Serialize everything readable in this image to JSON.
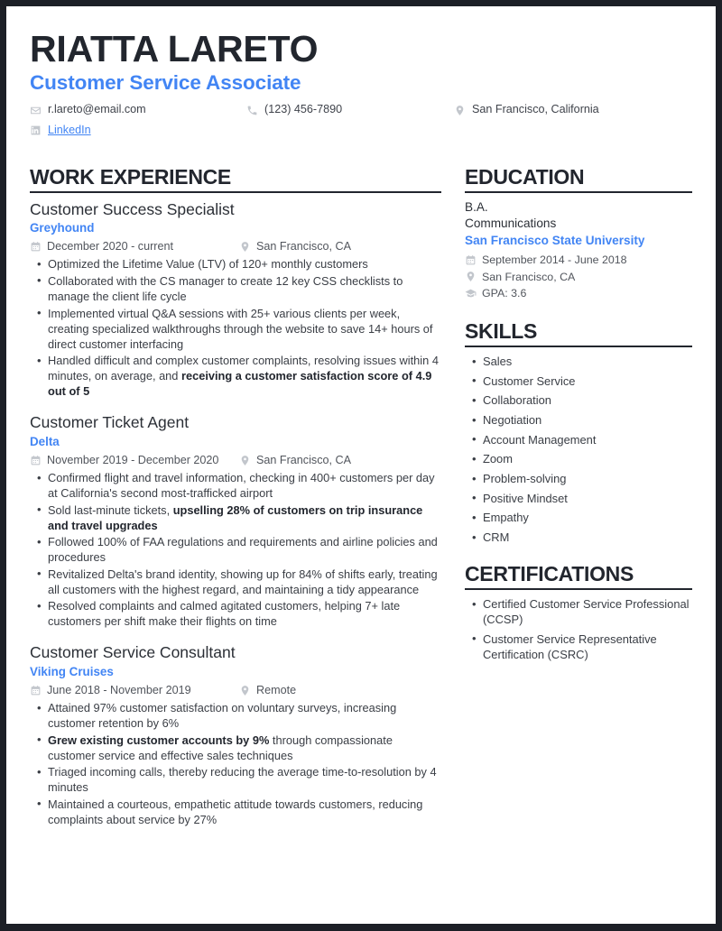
{
  "header": {
    "name": "RIATTA LARETO",
    "job_title": "Customer Service Associate",
    "contacts": {
      "email": "r.lareto@email.com",
      "phone": "(123) 456-7890",
      "location": "San Francisco, California",
      "linkedin": "LinkedIn"
    }
  },
  "accent_color": "#4285f4",
  "text_color": "#22262e",
  "work": {
    "section_title": "WORK EXPERIENCE",
    "entries": [
      {
        "title": "Customer Success Specialist",
        "org": "Greyhound",
        "date": "December 2020 - current",
        "location": "San Francisco, CA",
        "bullets": [
          [
            {
              "t": "Optimized the Lifetime Value (LTV) of 120+ monthly customers",
              "b": false
            }
          ],
          [
            {
              "t": "Collaborated with the CS manager to create 12 key CSS checklists to manage the client life cycle",
              "b": false
            }
          ],
          [
            {
              "t": "Implemented virtual Q&A sessions with 25+ various clients per week, creating specialized walkthroughs through the website to save 14+ hours of direct customer interfacing",
              "b": false
            }
          ],
          [
            {
              "t": "Handled difficult and complex customer complaints, resolving issues within 4 minutes, on average, and ",
              "b": false
            },
            {
              "t": "receiving a customer satisfaction score of 4.9 out of 5",
              "b": true
            }
          ]
        ]
      },
      {
        "title": "Customer Ticket Agent",
        "org": "Delta",
        "date": "November 2019 - December 2020",
        "location": "San Francisco, CA",
        "bullets": [
          [
            {
              "t": "Confirmed flight and travel information, checking in 400+ customers per day at California's second most-trafficked airport",
              "b": false
            }
          ],
          [
            {
              "t": "Sold last-minute tickets, ",
              "b": false
            },
            {
              "t": "upselling 28% of customers on trip insurance and travel upgrades",
              "b": true
            }
          ],
          [
            {
              "t": "Followed 100% of FAA regulations and requirements and airline policies and procedures",
              "b": false
            }
          ],
          [
            {
              "t": "Revitalized Delta's brand identity, showing up for 84% of shifts early, treating all customers with the highest regard, and maintaining a tidy appearance",
              "b": false
            }
          ],
          [
            {
              "t": "Resolved complaints and calmed agitated customers, helping 7+ late customers per shift make their flights on time",
              "b": false
            }
          ]
        ]
      },
      {
        "title": "Customer Service Consultant",
        "org": "Viking Cruises",
        "date": "June 2018 - November 2019",
        "location": "Remote",
        "bullets": [
          [
            {
              "t": "Attained 97% customer satisfaction on voluntary surveys, increasing customer retention by 6%",
              "b": false
            }
          ],
          [
            {
              "t": "Grew existing customer accounts by 9%",
              "b": true
            },
            {
              "t": " through compassionate customer service and effective sales techniques",
              "b": false
            }
          ],
          [
            {
              "t": "Triaged incoming calls, thereby reducing the average time-to-resolution by 4 minutes",
              "b": false
            }
          ],
          [
            {
              "t": "Maintained a courteous, empathetic attitude towards customers, reducing complaints about service by 27%",
              "b": false
            }
          ]
        ]
      }
    ]
  },
  "education": {
    "section_title": "EDUCATION",
    "degree": "B.A.",
    "field": "Communications",
    "school": "San Francisco State University",
    "date": "September 2014 - June 2018",
    "location": "San Francisco, CA",
    "gpa": "GPA: 3.6"
  },
  "skills": {
    "section_title": "SKILLS",
    "items": [
      "Sales",
      "Customer Service",
      "Collaboration",
      "Negotiation",
      "Account Management",
      "Zoom",
      "Problem-solving",
      "Positive Mindset",
      "Empathy",
      "CRM"
    ]
  },
  "certifications": {
    "section_title": "CERTIFICATIONS",
    "items": [
      "Certified Customer Service Professional (CCSP)",
      "Customer Service Representative Certification (CSRC)"
    ]
  },
  "icons": {
    "email": "envelope-icon",
    "phone": "phone-icon",
    "location": "map-pin-icon",
    "linkedin": "linkedin-icon",
    "calendar": "calendar-icon",
    "graduation": "graduation-cap-icon"
  }
}
